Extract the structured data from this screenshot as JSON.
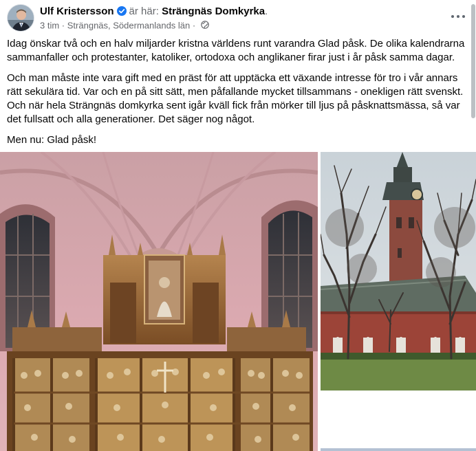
{
  "post": {
    "author": "Ulf Kristersson",
    "at_prefix": "är här:",
    "place": "Strängnäs Domkyrka",
    "place_suffix": ".",
    "time": "3 tim",
    "separator": "·",
    "location": "Strängnäs, Södermanlands län",
    "privacy_icon": "globe-icon",
    "verified_icon": "verified-badge-icon",
    "more_icon": "more-options-icon",
    "paragraphs": [
      "Idag önskar två och en halv miljarder kristna världens runt varandra Glad påsk. De olika kalendrarna sammanfaller och protestanter, katoliker, ortodoxa och anglikaner firar just i år påsk samma dagar.",
      "Och man måste inte vara gift med en präst för att upptäcka ett växande intresse för tro i vår annars rätt sekulära tid. Var och en på sitt sätt, men påfallande mycket tillsammans - onekligen rätt svenskt. Och när hela Strängnäs domkyrka sent igår kväll fick från mörker till ljus på påsknattsmässa, så var det fullsatt och alla generationer. Det säger nog något.",
      "Men nu: Glad påsk!"
    ]
  },
  "photos": [
    {
      "subject": "church-interior-altarpiece"
    },
    {
      "subject": "church-exterior-tower"
    },
    {
      "subject": "additional-photo"
    }
  ],
  "colors": {
    "verified": "#1877f2",
    "secondary_text": "#65676b",
    "vault_pink": "#d9a0a8"
  }
}
